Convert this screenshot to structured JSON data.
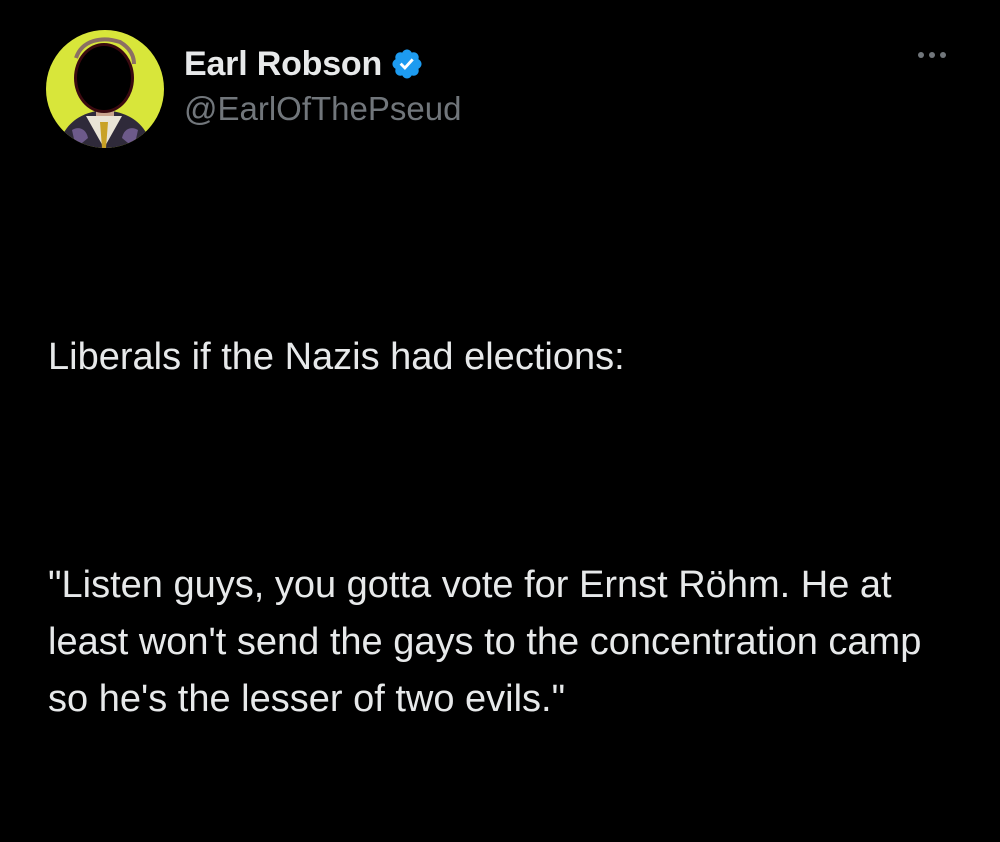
{
  "tweet": {
    "author": {
      "display_name": "Earl Robson",
      "handle": "@EarlOfThePseud",
      "verified": true,
      "verified_icon": "verified-badge-icon",
      "avatar_icon": "profile-avatar"
    },
    "more_icon": "more-options-icon",
    "text": {
      "line1": "Liberals if the Nazis had elections:",
      "line2": "\"Listen guys, you gotta vote for Ernst Röhm. He at least won't send the gays to the concentration camp so he's the lesser of two evils.\""
    }
  },
  "colors": {
    "background": "#000000",
    "text_primary": "#e7e9ea",
    "text_secondary": "#71767b",
    "verified_blue": "#1d9bf0",
    "avatar_bg": "#d8e63a"
  }
}
